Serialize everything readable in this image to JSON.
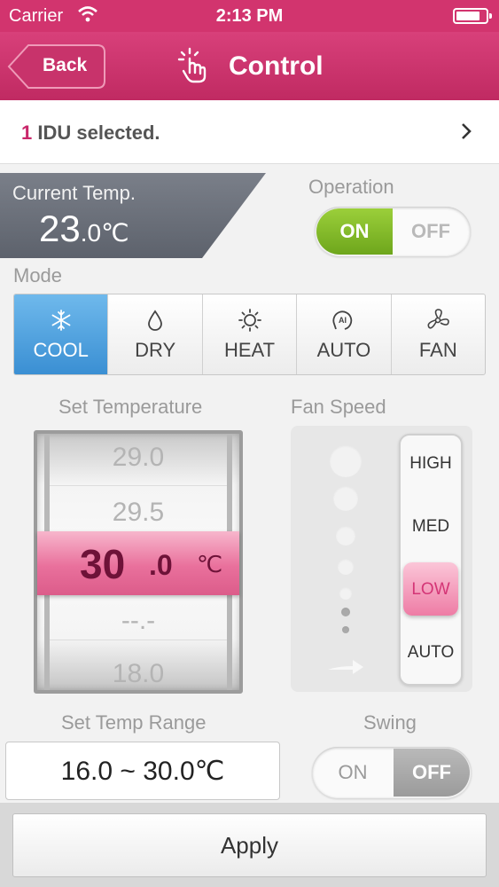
{
  "status_bar": {
    "carrier": "Carrier",
    "time": "2:13 PM"
  },
  "header": {
    "back_label": "Back",
    "title": "Control",
    "title_icon": "touch-hand-icon"
  },
  "selection": {
    "count": "1",
    "label": "IDU selected."
  },
  "current_temp": {
    "label": "Current Temp.",
    "whole": "23",
    "decimal": ".0",
    "unit": "℃"
  },
  "operation": {
    "label": "Operation",
    "on": "ON",
    "off": "OFF",
    "state": "ON",
    "active_color": "#7db22a"
  },
  "mode": {
    "label": "Mode",
    "selected": "COOL",
    "items": [
      {
        "label": "COOL",
        "icon": "snowflake-icon"
      },
      {
        "label": "DRY",
        "icon": "droplet-icon"
      },
      {
        "label": "HEAT",
        "icon": "sun-icon"
      },
      {
        "label": "AUTO",
        "icon": "auto-ai-icon"
      },
      {
        "label": "FAN",
        "icon": "fan-icon"
      }
    ],
    "active_color": "#4a9ddc"
  },
  "set_temperature": {
    "label": "Set Temperature",
    "above": [
      "29.0",
      "29.5"
    ],
    "selected_whole": "30",
    "selected_decimal": ".0",
    "unit": "℃",
    "below": [
      "--.-",
      "18.0"
    ],
    "highlight_color": "#e9709c"
  },
  "fan_speed": {
    "label": "Fan Speed",
    "options": [
      "HIGH",
      "MED",
      "LOW",
      "AUTO"
    ],
    "selected": "LOW"
  },
  "temp_range": {
    "label": "Set Temp Range",
    "value": "16.0 ~ 30.0℃"
  },
  "swing": {
    "label": "Swing",
    "on": "ON",
    "off": "OFF",
    "state": "OFF"
  },
  "apply_label": "Apply"
}
